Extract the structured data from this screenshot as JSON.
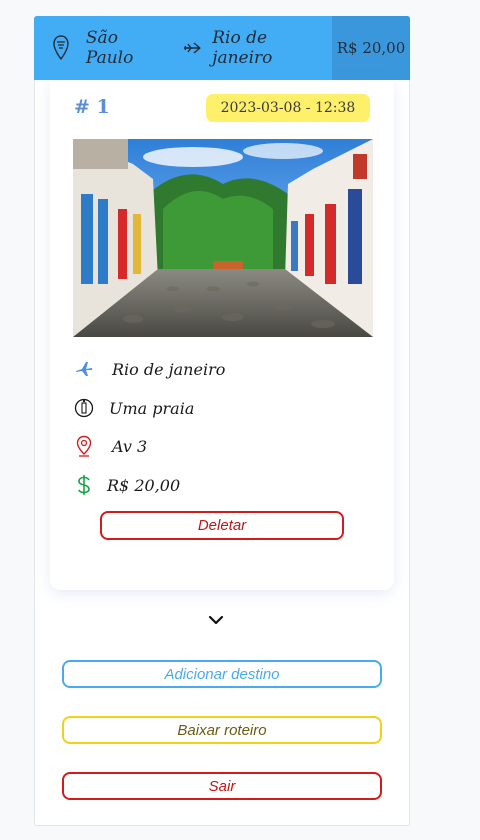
{
  "trip": {
    "origin": "São Paulo",
    "destination": "Rio de janeiro",
    "total_price": "R$ 20,00"
  },
  "destination_card": {
    "number": "# 1",
    "datetime": "2023-03-08 - 12:38",
    "city": "Rio de janeiro",
    "place": "Uma praia",
    "address": "Av 3",
    "cost": "R$ 20,00",
    "delete_label": "Deletar",
    "image_icon": "street-photo"
  },
  "actions": {
    "add_label": "Adicionar destino",
    "download_label": "Baixar roteiro",
    "exit_label": "Sair"
  },
  "colors": {
    "header_bg": "#42adf5",
    "price_bg": "#3b97dc",
    "date_badge": "#fff06b",
    "danger": "#d21b1b",
    "primary": "#4aaaf0",
    "warning": "#f0d21c",
    "money": "#1aa34a"
  },
  "icons": [
    "map-pin-icon",
    "plane-icon",
    "plane-icon",
    "place-icon",
    "location-icon",
    "dollar-icon",
    "chevron-down-icon"
  ]
}
